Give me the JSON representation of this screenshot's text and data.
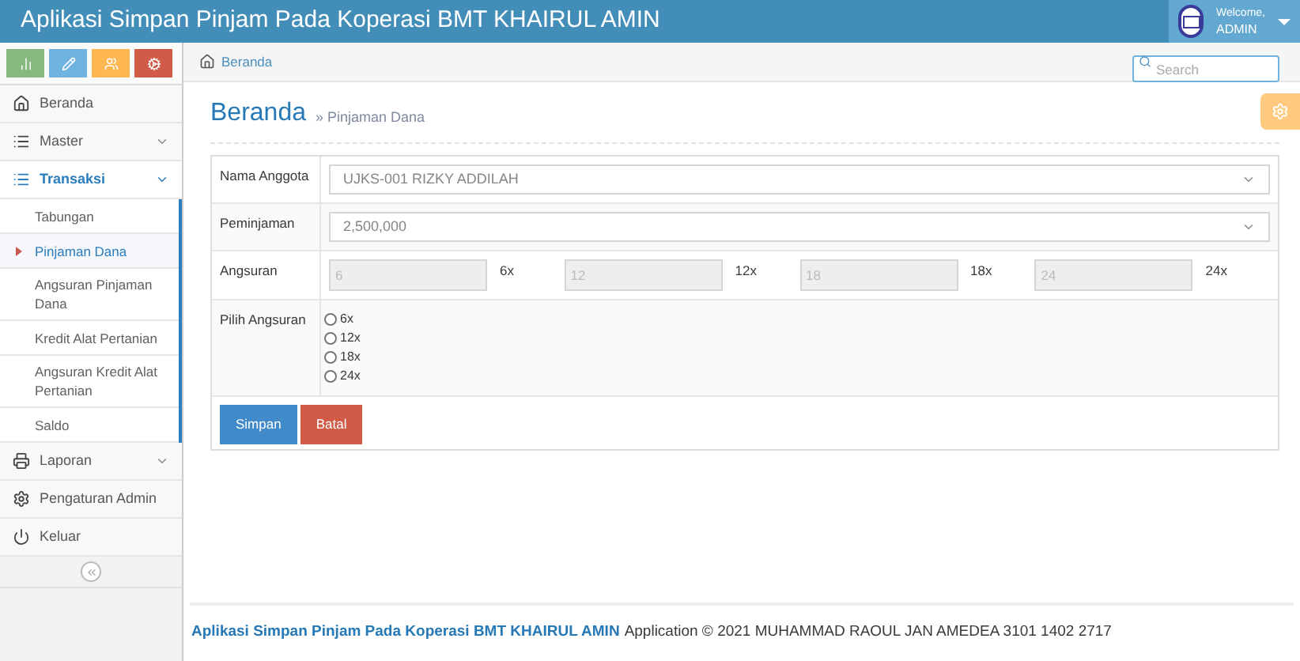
{
  "header": {
    "title": "Aplikasi Simpan Pinjam Pada Koperasi BMT KHAIRUL AMIN",
    "welcome": "Welcome,",
    "user": "ADMIN"
  },
  "shortcuts": [
    {
      "color": "#87b87f"
    },
    {
      "color": "#6fb3e0"
    },
    {
      "color": "#ffb752"
    },
    {
      "color": "#d15b47"
    }
  ],
  "sidebar": {
    "items": [
      {
        "label": "Beranda",
        "selected": false
      },
      {
        "label": "Master",
        "selected": false,
        "expanded": false
      },
      {
        "label": "Transaksi",
        "selected": true,
        "expanded": true,
        "children": [
          {
            "label": "Tabungan",
            "selected": false
          },
          {
            "label": "Pinjaman Dana",
            "selected": true
          },
          {
            "label": "Angsuran Pinjaman Dana",
            "selected": false
          },
          {
            "label": "Kredit Alat Pertanian",
            "selected": false
          },
          {
            "label": "Angsuran Kredit Alat Pertanian",
            "selected": false
          },
          {
            "label": "Saldo",
            "selected": false
          }
        ]
      },
      {
        "label": "Laporan",
        "selected": false,
        "expanded": false
      },
      {
        "label": "Pengaturan Admin",
        "selected": false
      },
      {
        "label": "Keluar",
        "selected": false
      }
    ]
  },
  "breadcrumb": "Beranda",
  "search": {
    "placeholder": "Search"
  },
  "page": {
    "title": "Beranda",
    "subtitle": "» Pinjaman Dana"
  },
  "form": {
    "nama_anggota": {
      "label": "Nama Anggota",
      "value": "UJKS-001 RIZKY ADDILAH"
    },
    "peminjaman": {
      "label": "Peminjaman",
      "value": "2,500,000"
    },
    "angsuran": {
      "label": "Angsuran",
      "fields": [
        {
          "placeholder": "6",
          "suffix": "6x"
        },
        {
          "placeholder": "12",
          "suffix": "12x"
        },
        {
          "placeholder": "18",
          "suffix": "18x"
        },
        {
          "placeholder": "24",
          "suffix": "24x"
        }
      ]
    },
    "pilih_angsuran": {
      "label": "Pilih Angsuran",
      "options": [
        {
          "label": "6x",
          "selected": false
        },
        {
          "label": "12x",
          "selected": false
        },
        {
          "label": "18x",
          "selected": false
        },
        {
          "label": "24x",
          "selected": false
        }
      ]
    },
    "buttons": [
      {
        "label": "Simpan",
        "kind": "primary"
      },
      {
        "label": "Batal",
        "kind": "danger"
      }
    ]
  },
  "footer": {
    "link": "Aplikasi Simpan Pinjam Pada Koperasi BMT KHAIRUL AMIN",
    "text": "Application © 2021 MUHAMMAD RAOUL JAN AMEDEA 3101 1402 2717"
  }
}
